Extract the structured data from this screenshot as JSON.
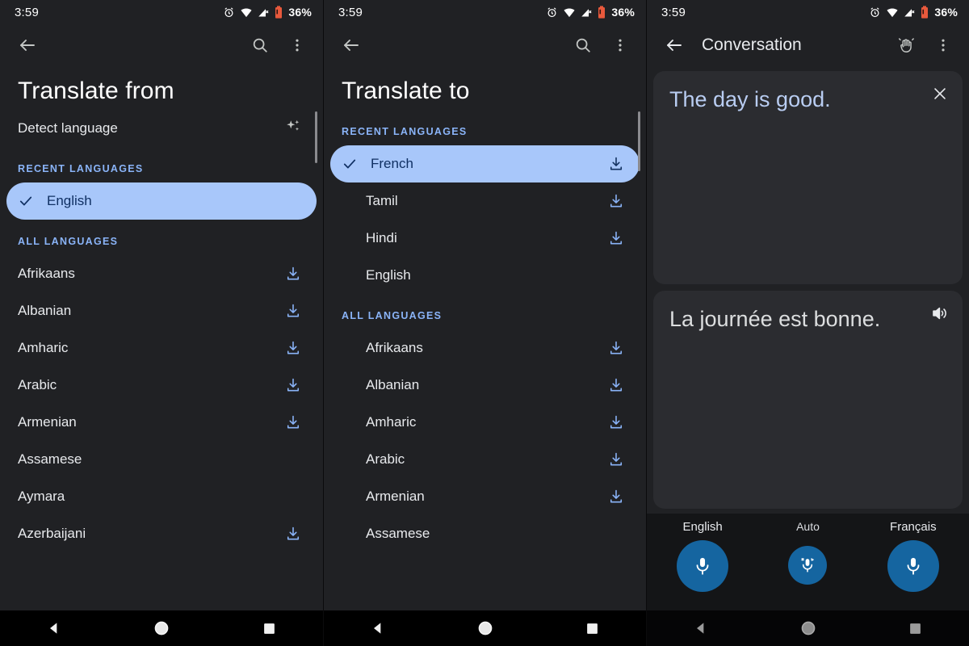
{
  "statusbar": {
    "time": "3:59",
    "battery_percent": "36%",
    "icons": [
      "alarm-icon",
      "wifi-icon",
      "signal-off-icon",
      "battery-low-icon"
    ]
  },
  "colors": {
    "page_background": "#202124",
    "accent_blue": "#8ab4f8",
    "selected_pill": "#a8c7fa",
    "selected_pill_text": "#103063",
    "card_background": "#2b2c30",
    "mic_button": "#1565a0",
    "source_text": "#b9cdf2"
  },
  "panel1": {
    "appbar": {
      "back": "back-arrow-icon",
      "search": "search-icon",
      "overflow": "more-vertical-icon"
    },
    "title": "Translate from",
    "detect": {
      "label": "Detect language",
      "icon": "sparkle-icon"
    },
    "recent_header": "RECENT LANGUAGES",
    "recent": [
      {
        "name": "English",
        "selected": true,
        "download": false
      }
    ],
    "all_header": "ALL LANGUAGES",
    "all": [
      {
        "name": "Afrikaans",
        "download": true
      },
      {
        "name": "Albanian",
        "download": true
      },
      {
        "name": "Amharic",
        "download": true
      },
      {
        "name": "Arabic",
        "download": true
      },
      {
        "name": "Armenian",
        "download": true
      },
      {
        "name": "Assamese",
        "download": false
      },
      {
        "name": "Aymara",
        "download": false
      },
      {
        "name": "Azerbaijani",
        "download": true
      }
    ]
  },
  "panel2": {
    "appbar": {
      "back": "back-arrow-icon",
      "search": "search-icon",
      "overflow": "more-vertical-icon"
    },
    "title": "Translate to",
    "recent_header": "RECENT LANGUAGES",
    "recent": [
      {
        "name": "French",
        "selected": true,
        "download": true
      },
      {
        "name": "Tamil",
        "selected": false,
        "download": true
      },
      {
        "name": "Hindi",
        "selected": false,
        "download": true
      },
      {
        "name": "English",
        "selected": false,
        "download": false
      }
    ],
    "all_header": "ALL LANGUAGES",
    "all": [
      {
        "name": "Afrikaans",
        "download": true
      },
      {
        "name": "Albanian",
        "download": true
      },
      {
        "name": "Amharic",
        "download": true
      },
      {
        "name": "Arabic",
        "download": true
      },
      {
        "name": "Armenian",
        "download": true
      },
      {
        "name": "Assamese",
        "download": false
      }
    ]
  },
  "panel3": {
    "appbar": {
      "back": "back-arrow-icon",
      "title": "Conversation",
      "gesture": "waving-hand-icon",
      "overflow": "more-vertical-icon"
    },
    "source_bubble": {
      "text": "The day is good.",
      "action": "close-icon"
    },
    "target_bubble": {
      "text": "La journée est bonne.",
      "action": "speaker-icon"
    },
    "mics": [
      {
        "label": "English",
        "size": "large",
        "icon": "microphone-icon"
      },
      {
        "label": "Auto",
        "size": "small",
        "icon": "microphone-auto-icon"
      },
      {
        "label": "Français",
        "size": "large",
        "icon": "microphone-icon"
      }
    ]
  },
  "navbar": {
    "back": "nav-back-triangle-icon",
    "home": "nav-home-circle-icon",
    "recents": "nav-recents-square-icon"
  }
}
